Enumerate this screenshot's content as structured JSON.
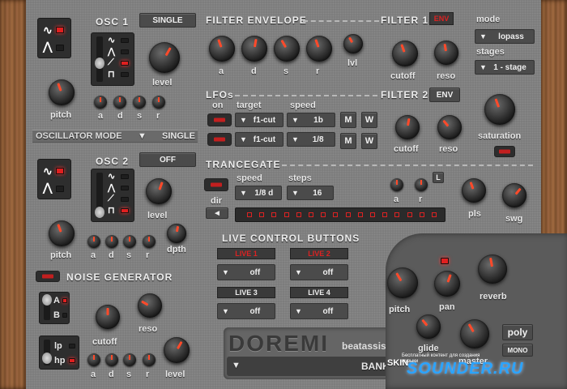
{
  "osc1": {
    "title": "OSC 1",
    "mode_button": "SINGLE",
    "level": "level",
    "pitch": "pitch",
    "adsr": [
      "a",
      "d",
      "s",
      "r"
    ]
  },
  "osc_mode": {
    "label": "OSCILLATOR MODE",
    "arrow": "▼",
    "value": "SINGLE"
  },
  "osc2": {
    "title": "OSC 2",
    "mode_button": "OFF",
    "level": "level",
    "pitch": "pitch",
    "adsr": [
      "a",
      "d",
      "s",
      "r"
    ],
    "depth": "dpth"
  },
  "noise": {
    "title": "NOISE GENERATOR",
    "switch_a": "A",
    "switch_b": "B",
    "cutoff": "cutoff",
    "reso": "reso",
    "filter_lp": "lp",
    "filter_hp": "hp",
    "adsr": [
      "a",
      "d",
      "s",
      "r"
    ],
    "level": "level"
  },
  "filter_env": {
    "title": "FILTER ENVELOPE",
    "labels": [
      "a",
      "d",
      "s",
      "r",
      "lvl"
    ]
  },
  "filter1": {
    "title": "FILTER 1",
    "env_label": "ENV",
    "mode_label": "mode",
    "mode_value": "lopass",
    "stages_label": "stages",
    "stages_value": "1 - stage",
    "cutoff": "cutoff",
    "reso": "reso"
  },
  "filter2": {
    "title": "FILTER 2",
    "env_label": "ENV",
    "cutoff": "cutoff",
    "reso": "reso",
    "saturation": "saturation"
  },
  "lfos": {
    "title": "LFOs",
    "on_label": "on",
    "target_label": "target",
    "speed_label": "speed",
    "rows": [
      {
        "target": "f1-cut",
        "speed": "1b",
        "m": "M",
        "w": "W"
      },
      {
        "target": "f1-cut",
        "speed": "1/8",
        "m": "M",
        "w": "W"
      }
    ]
  },
  "trancegate": {
    "title": "TRANCEGATE",
    "speed_label": "speed",
    "speed_value": "1/8 d",
    "steps_label": "steps",
    "steps_value": "16",
    "dir": "dir",
    "dir_arrow": "◄",
    "a": "a",
    "r": "r",
    "l_badge": "L",
    "pls": "pls",
    "swg": "swg"
  },
  "live": {
    "title": "LIVE CONTROL BUTTONS",
    "buttons": [
      {
        "label": "LIVE 1",
        "value": "off"
      },
      {
        "label": "LIVE 2",
        "value": "off"
      },
      {
        "label": "LIVE 3",
        "value": "off"
      },
      {
        "label": "LIVE 4",
        "value": "off"
      }
    ]
  },
  "master": {
    "pitch": "pitch",
    "pan": "pan",
    "reverb": "reverb",
    "glide": "glide",
    "master": "master",
    "poly": "poly",
    "mono": "MONO",
    "skin": "SKIN"
  },
  "brand": {
    "name": "DOREMI",
    "site": "beatassist.eu",
    "bank": "BANK",
    "bank_arrow": "▼",
    "left_arrow": "▼",
    "watermark": "SOUNDER.RU",
    "watermark_sub": "Бесплатный контент для создания музыки"
  },
  "icons": {
    "wave_sine": "sine-wave-icon",
    "wave_tri": "triangle-wave-icon",
    "wave_saw": "saw-wave-icon",
    "wave_square": "square-wave-icon"
  },
  "colors": {
    "panel": "#7d7d7d",
    "accent": "#e02020",
    "wood": "#8a5a36"
  }
}
